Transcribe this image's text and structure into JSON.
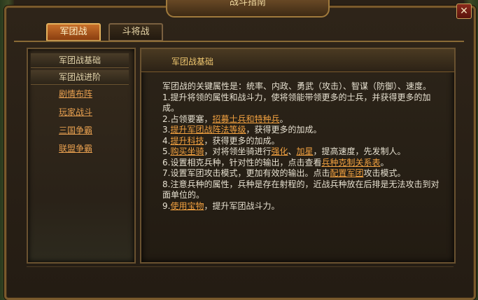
{
  "window": {
    "title": "战斗指南",
    "close_label": "✕"
  },
  "tabs": [
    {
      "label": "军团战",
      "active": true
    },
    {
      "label": "斗将战",
      "active": false
    }
  ],
  "sidebar": {
    "headers": [
      "军团战基础",
      "军团战进阶"
    ],
    "links": [
      "剧情布阵",
      "玩家战斗",
      "三国争霸",
      "联盟争霸"
    ]
  },
  "content": {
    "title": "军团战基础",
    "intro": "军团战的关键属性是：统率、内政、勇武（攻击）、智谋（防御）、速度。",
    "item1": "1.提升将领的属性和战斗力，使将领能带领更多的士兵，并获得更多的加成。",
    "item2": {
      "prefix": "2.占领要塞，",
      "link": "招募士兵和特种兵",
      "suffix": "。"
    },
    "item3": {
      "prefix": "3.",
      "link": "提升军团战阵法等级",
      "suffix": "，获得更多的加成。"
    },
    "item4": {
      "prefix": "4.",
      "link": "提升科技",
      "suffix": "，获得更多的加成。"
    },
    "item5": {
      "prefix": "5.",
      "link": "购买坐骑",
      "mid1": "，对将领坐骑进行",
      "link2": "强化",
      "mid2": "、",
      "link3": "加星",
      "suffix": "，提高速度，先发制人。"
    },
    "item6": {
      "prefix": "6.设置相克兵种，针对性的输出，点击查看",
      "link": "兵种克制关系表",
      "suffix": "。"
    },
    "item7": {
      "prefix": "7.设置军团攻击模式，更加有效的输出。点击",
      "link": "配置军团",
      "suffix": "攻击模式。"
    },
    "item8": "8.注意兵种的属性，兵种是存在射程的，近战兵种放在后排是无法攻击到对面单位的。",
    "item9": {
      "prefix": "9.",
      "link": "使用宝物",
      "suffix": "，提升军团战斗力。"
    }
  },
  "colors": {
    "accent": "#f0a040",
    "text": "#e6e0d0",
    "border": "#7a5a2c"
  }
}
